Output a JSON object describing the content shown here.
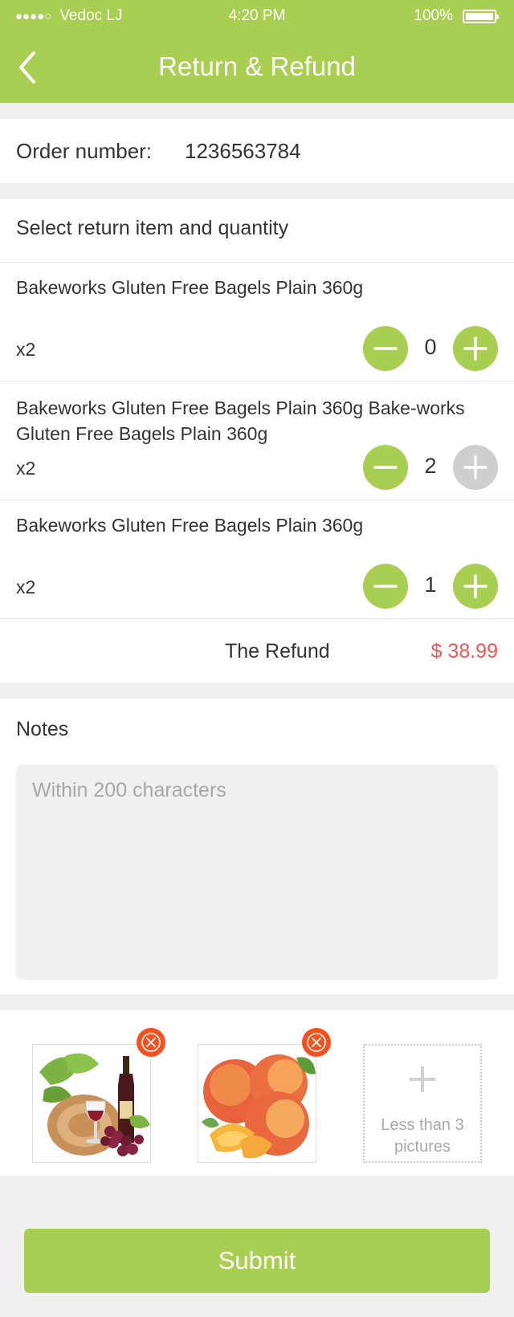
{
  "status_bar": {
    "signal_dots": "●●●●○",
    "carrier": "Vedoc LJ",
    "time": "4:20 PM",
    "battery_percent": "100%"
  },
  "header": {
    "title": "Return & Refund",
    "back_icon": "chevron-left-icon"
  },
  "order": {
    "label": "Order number:",
    "number": "1236563784"
  },
  "items_section": {
    "title": "Select return item and quantity",
    "items": [
      {
        "name": "Bakeworks Gluten Free Bagels Plain 360g",
        "count": "x2",
        "quantity": "0",
        "plus_enabled": true
      },
      {
        "name": "Bakeworks Gluten Free Bagels Plain 360g Bake-works Gluten Free Bagels Plain 360g",
        "count": "x2",
        "quantity": "2",
        "plus_enabled": false
      },
      {
        "name": "Bakeworks Gluten Free Bagels Plain 360g",
        "count": "x2",
        "quantity": "1",
        "plus_enabled": true
      }
    ],
    "refund_label": "The Refund",
    "refund_amount": "$ 38.99"
  },
  "notes": {
    "title": "Notes",
    "placeholder": "Within 200 characters",
    "value": ""
  },
  "photos": {
    "items": [
      {
        "subject": "wine-grapes-photo"
      },
      {
        "subject": "peaches-photo"
      }
    ],
    "add_hint": "Less than 3 pictures"
  },
  "submit_label": "Submit",
  "colors": {
    "accent": "#a8ce52",
    "price": "#f5544f",
    "delete": "#f4511e",
    "disabled": "#cfcfcf"
  }
}
